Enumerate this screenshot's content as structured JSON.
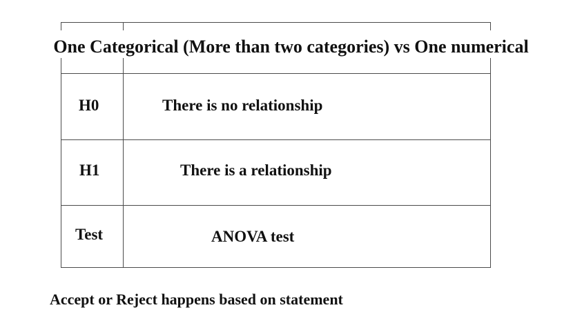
{
  "table": {
    "header": "One Categorical (More than two categories) vs One numerical",
    "rows": [
      {
        "label": "H0",
        "value": "There is no relationship"
      },
      {
        "label": "H1",
        "value": "There is a relationship"
      },
      {
        "label": "Test",
        "value": "ANOVA test"
      }
    ]
  },
  "footer_text": "Accept or Reject happens based on statement"
}
